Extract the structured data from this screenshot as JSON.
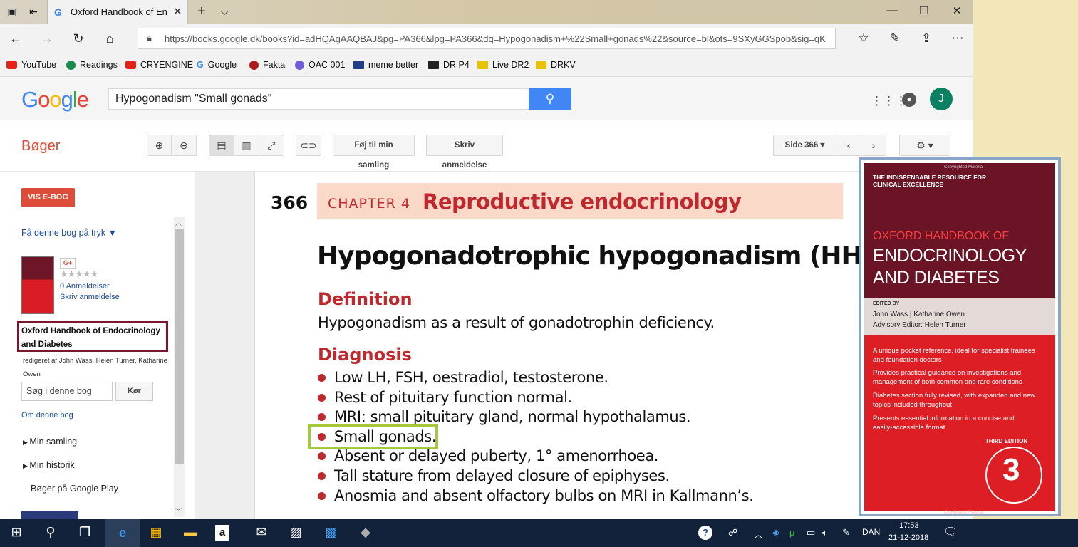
{
  "browser": {
    "tab_title": "Oxford Handbook of En",
    "tab_favicon": "G",
    "url": "https://books.google.dk/books?id=adHQAgAAQBAJ&pg=PA366&lpg=PA366&dq=Hypogonadism+%22Small+gonads%22&source=bl&ots=9SXyGGSpob&sig=qK",
    "favorites": [
      "YouTube",
      "Readings",
      "CRYENGINE",
      "Google",
      "Fakta",
      "OAC 001",
      "meme better",
      "DR P4",
      "Live DR2",
      "DRKV"
    ]
  },
  "google": {
    "logo": "Google",
    "query": "Hypogonadism \"Small gonads\"",
    "avatar_letter": "J"
  },
  "toolbar": {
    "section": "Bøger",
    "add_collection": "Føj til min samling",
    "write_review": "Skriv anmeldelse",
    "page_select": "Side 366"
  },
  "sidebar": {
    "ebook_button": "VIS E-BOG",
    "get_book": "Få denne bog på tryk ▼",
    "gplus": "G+",
    "stars": "★★★★★",
    "reviews": "0 Anmeldelser",
    "write_review": "Skriv anmeldelse",
    "book_title": "Oxford Handbook of Endocrinology and Diabetes",
    "authors": "redigeret af John Wass, Helen Turner, Katharine Owen",
    "search_placeholder": "Søg i denne bog",
    "search_button": "Kør",
    "about": "Om denne bog",
    "my_collection": "Min samling",
    "my_history": "Min historik",
    "play_books": "Bøger på Google Play"
  },
  "page": {
    "number": "366",
    "chapter_label": "CHAPTER 4",
    "chapter_title": "Reproductive endocrinology",
    "heading": "Hypogonadotrophic hypogonadism (HH)",
    "definition_title": "Definition",
    "definition_text": "Hypogonadism as a result of gonadotrophin deficiency.",
    "diagnosis_title": "Diagnosis",
    "diagnosis_items": [
      "Low LH, FSH, oestradiol, testosterone.",
      "Rest of pituitary function normal.",
      "MRI: small pituitary gland, normal hypothalamus.",
      "Small gonads.",
      "Absent or delayed puberty, 1° amenorrhoea.",
      "Tall stature from delayed closure of epiphyses.",
      "Anosmia and absent olfactory bulbs on MRI in Kallmann’s."
    ]
  },
  "cover": {
    "copyright": "Copyrighted Material",
    "tagline_1": "THE INDISPENSABLE RESOURCE FOR",
    "tagline_2": "CLINICAL EXCELLENCE",
    "series": "OXFORD HANDBOOK OF",
    "title_1": "ENDOCRINOLOGY",
    "title_2": "AND DIABETES",
    "edited_by": "EDITED BY",
    "editors": "John Wass | Katharine Owen",
    "advisory": "Advisory Editor: Helen Turner",
    "blurb": [
      "A unique pocket reference, ideal for specialist trainees",
      "and foundation doctors",
      "Provides practical guidance on investigations and",
      "management of both common and rare conditions",
      "Diabetes section fully revised, with expanded and new",
      "topics included throughout",
      "Presents essential information in a concise and",
      "easily-accessible format"
    ],
    "edition_number": "3",
    "edition_text": "THIRD EDITION",
    "copyright_bottom": "Copyrighted Material"
  },
  "taskbar": {
    "language": "DAN",
    "time": "17:53",
    "date": "21-12-2018"
  }
}
